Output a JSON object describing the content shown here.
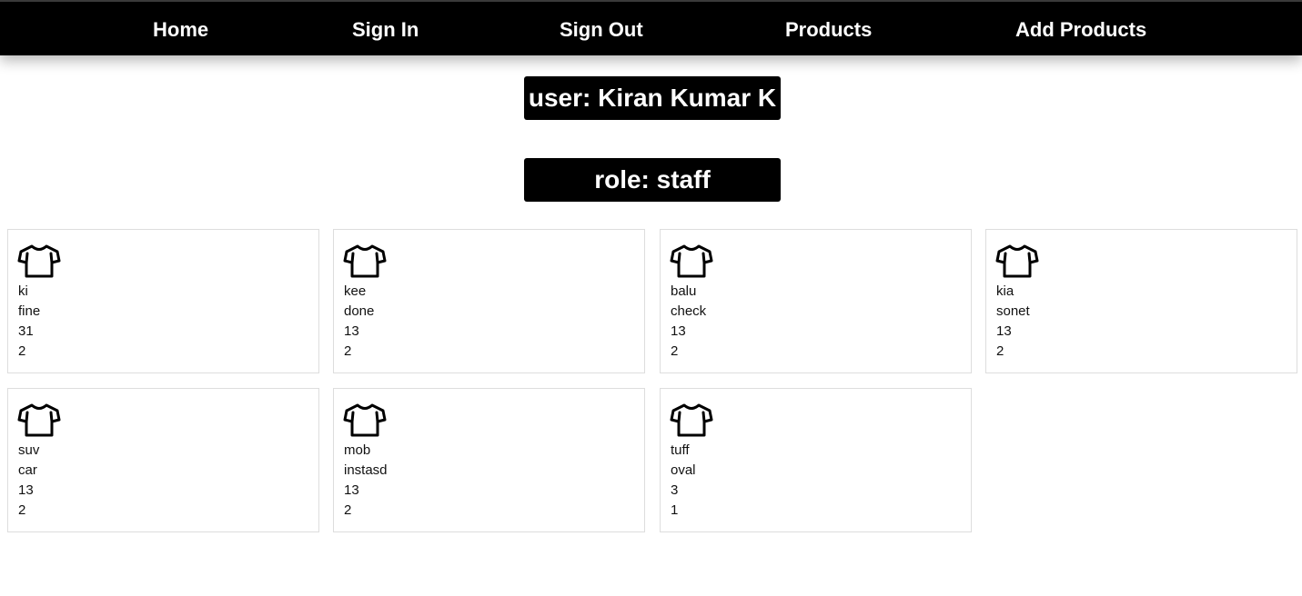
{
  "nav": {
    "home": "Home",
    "sign_in": "Sign In",
    "sign_out": "Sign Out",
    "products": "Products",
    "add_products": "Add Products"
  },
  "user_label": "user: Kiran Kumar K",
  "role_label": "role: staff",
  "products": [
    {
      "name": "ki",
      "description": "fine",
      "price": "31",
      "quantity": "2",
      "icon": "tshirt-icon"
    },
    {
      "name": "kee",
      "description": "done",
      "price": "13",
      "quantity": "2",
      "icon": "tshirt-icon"
    },
    {
      "name": "balu",
      "description": "check",
      "price": "13",
      "quantity": "2",
      "icon": "tshirt-icon"
    },
    {
      "name": "kia",
      "description": "sonet",
      "price": "13",
      "quantity": "2",
      "icon": "tshirt-icon"
    },
    {
      "name": "suv",
      "description": "car",
      "price": "13",
      "quantity": "2",
      "icon": "tshirt-icon"
    },
    {
      "name": "mob",
      "description": "instasd",
      "price": "13",
      "quantity": "2",
      "icon": "tshirt-icon"
    },
    {
      "name": "tuff",
      "description": "oval",
      "price": "3",
      "quantity": "1",
      "icon": "tshirt-icon"
    }
  ],
  "colors": {
    "navbar_bg": "#000000",
    "navbar_text": "#ffffff",
    "card_border": "#dddddd"
  }
}
